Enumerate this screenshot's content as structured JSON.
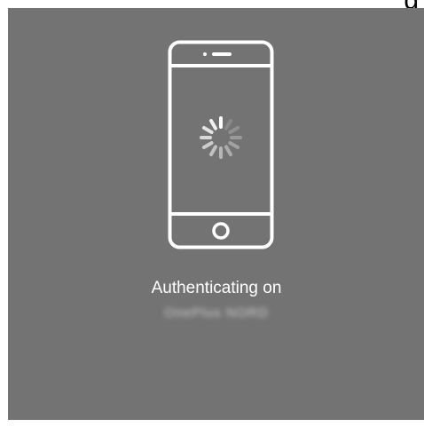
{
  "partial_heading": "g",
  "status": {
    "label": "Authenticating on",
    "device_name": "OnePlus NORD"
  },
  "icons": {
    "device": "smartphone-icon",
    "spinner": "loading-spinner-icon"
  },
  "colors": {
    "panel_background": "#737373",
    "foreground": "#ffffff"
  }
}
